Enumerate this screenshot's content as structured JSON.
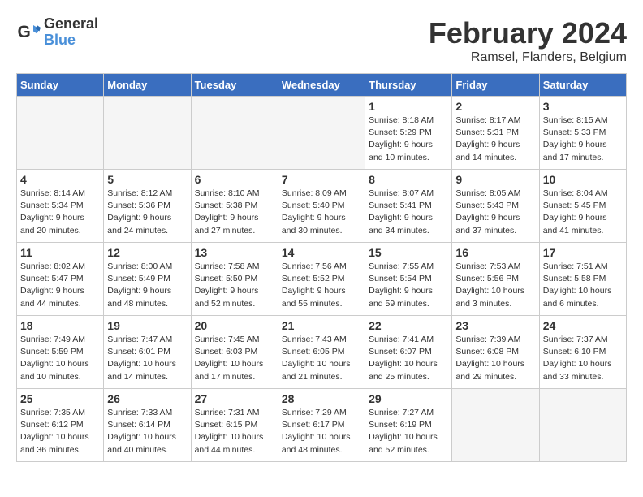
{
  "header": {
    "logo_line1": "General",
    "logo_line2": "Blue",
    "month_title": "February 2024",
    "location": "Ramsel, Flanders, Belgium"
  },
  "days_of_week": [
    "Sunday",
    "Monday",
    "Tuesday",
    "Wednesday",
    "Thursday",
    "Friday",
    "Saturday"
  ],
  "weeks": [
    [
      {
        "num": "",
        "info": ""
      },
      {
        "num": "",
        "info": ""
      },
      {
        "num": "",
        "info": ""
      },
      {
        "num": "",
        "info": ""
      },
      {
        "num": "1",
        "info": "Sunrise: 8:18 AM\nSunset: 5:29 PM\nDaylight: 9 hours\nand 10 minutes."
      },
      {
        "num": "2",
        "info": "Sunrise: 8:17 AM\nSunset: 5:31 PM\nDaylight: 9 hours\nand 14 minutes."
      },
      {
        "num": "3",
        "info": "Sunrise: 8:15 AM\nSunset: 5:33 PM\nDaylight: 9 hours\nand 17 minutes."
      }
    ],
    [
      {
        "num": "4",
        "info": "Sunrise: 8:14 AM\nSunset: 5:34 PM\nDaylight: 9 hours\nand 20 minutes."
      },
      {
        "num": "5",
        "info": "Sunrise: 8:12 AM\nSunset: 5:36 PM\nDaylight: 9 hours\nand 24 minutes."
      },
      {
        "num": "6",
        "info": "Sunrise: 8:10 AM\nSunset: 5:38 PM\nDaylight: 9 hours\nand 27 minutes."
      },
      {
        "num": "7",
        "info": "Sunrise: 8:09 AM\nSunset: 5:40 PM\nDaylight: 9 hours\nand 30 minutes."
      },
      {
        "num": "8",
        "info": "Sunrise: 8:07 AM\nSunset: 5:41 PM\nDaylight: 9 hours\nand 34 minutes."
      },
      {
        "num": "9",
        "info": "Sunrise: 8:05 AM\nSunset: 5:43 PM\nDaylight: 9 hours\nand 37 minutes."
      },
      {
        "num": "10",
        "info": "Sunrise: 8:04 AM\nSunset: 5:45 PM\nDaylight: 9 hours\nand 41 minutes."
      }
    ],
    [
      {
        "num": "11",
        "info": "Sunrise: 8:02 AM\nSunset: 5:47 PM\nDaylight: 9 hours\nand 44 minutes."
      },
      {
        "num": "12",
        "info": "Sunrise: 8:00 AM\nSunset: 5:49 PM\nDaylight: 9 hours\nand 48 minutes."
      },
      {
        "num": "13",
        "info": "Sunrise: 7:58 AM\nSunset: 5:50 PM\nDaylight: 9 hours\nand 52 minutes."
      },
      {
        "num": "14",
        "info": "Sunrise: 7:56 AM\nSunset: 5:52 PM\nDaylight: 9 hours\nand 55 minutes."
      },
      {
        "num": "15",
        "info": "Sunrise: 7:55 AM\nSunset: 5:54 PM\nDaylight: 9 hours\nand 59 minutes."
      },
      {
        "num": "16",
        "info": "Sunrise: 7:53 AM\nSunset: 5:56 PM\nDaylight: 10 hours\nand 3 minutes."
      },
      {
        "num": "17",
        "info": "Sunrise: 7:51 AM\nSunset: 5:58 PM\nDaylight: 10 hours\nand 6 minutes."
      }
    ],
    [
      {
        "num": "18",
        "info": "Sunrise: 7:49 AM\nSunset: 5:59 PM\nDaylight: 10 hours\nand 10 minutes."
      },
      {
        "num": "19",
        "info": "Sunrise: 7:47 AM\nSunset: 6:01 PM\nDaylight: 10 hours\nand 14 minutes."
      },
      {
        "num": "20",
        "info": "Sunrise: 7:45 AM\nSunset: 6:03 PM\nDaylight: 10 hours\nand 17 minutes."
      },
      {
        "num": "21",
        "info": "Sunrise: 7:43 AM\nSunset: 6:05 PM\nDaylight: 10 hours\nand 21 minutes."
      },
      {
        "num": "22",
        "info": "Sunrise: 7:41 AM\nSunset: 6:07 PM\nDaylight: 10 hours\nand 25 minutes."
      },
      {
        "num": "23",
        "info": "Sunrise: 7:39 AM\nSunset: 6:08 PM\nDaylight: 10 hours\nand 29 minutes."
      },
      {
        "num": "24",
        "info": "Sunrise: 7:37 AM\nSunset: 6:10 PM\nDaylight: 10 hours\nand 33 minutes."
      }
    ],
    [
      {
        "num": "25",
        "info": "Sunrise: 7:35 AM\nSunset: 6:12 PM\nDaylight: 10 hours\nand 36 minutes."
      },
      {
        "num": "26",
        "info": "Sunrise: 7:33 AM\nSunset: 6:14 PM\nDaylight: 10 hours\nand 40 minutes."
      },
      {
        "num": "27",
        "info": "Sunrise: 7:31 AM\nSunset: 6:15 PM\nDaylight: 10 hours\nand 44 minutes."
      },
      {
        "num": "28",
        "info": "Sunrise: 7:29 AM\nSunset: 6:17 PM\nDaylight: 10 hours\nand 48 minutes."
      },
      {
        "num": "29",
        "info": "Sunrise: 7:27 AM\nSunset: 6:19 PM\nDaylight: 10 hours\nand 52 minutes."
      },
      {
        "num": "",
        "info": ""
      },
      {
        "num": "",
        "info": ""
      }
    ]
  ]
}
